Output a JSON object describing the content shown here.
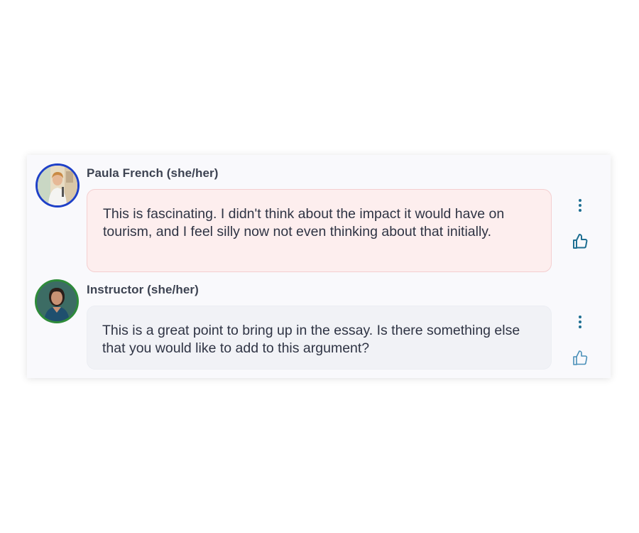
{
  "comments": [
    {
      "author": "Paula French (she/her)",
      "text": "This is fascinating. I didn't think about the impact it would have on tourism, and I feel silly now not even thinking about that initially.",
      "liked": true,
      "avatar_ring_color": "#1e40c8",
      "bubble_color": "#fdeeee"
    },
    {
      "author": "Instructor (she/her)",
      "text": "This is a great point to bring up in the essay. Is there something else that you would like to add to this argument?",
      "liked": false,
      "avatar_ring_color": "#2e8b3a",
      "bubble_color": "#f1f2f6"
    }
  ],
  "icons": {
    "more": "vertical-ellipsis-icon",
    "like": "thumbs-up-icon"
  },
  "colors": {
    "accent": "#1f6f92",
    "like_active": "#1f6f92",
    "like_inactive": "#4a90b8"
  }
}
